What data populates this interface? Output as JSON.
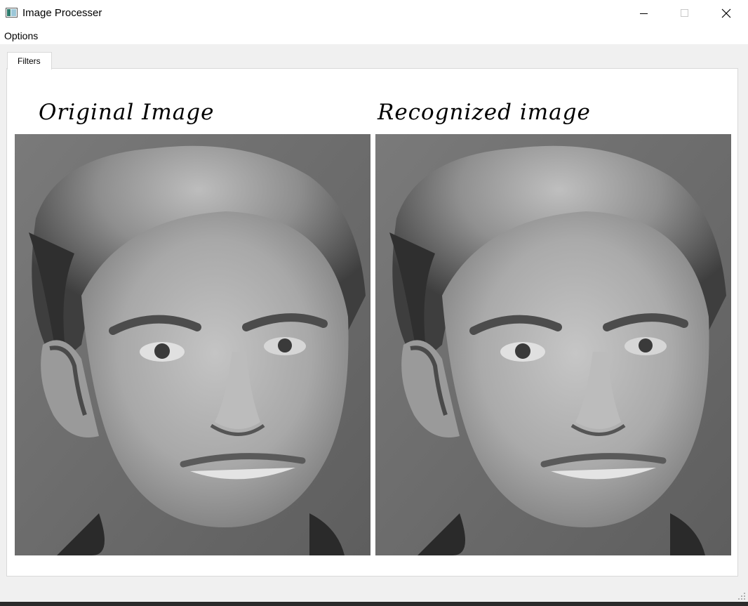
{
  "window": {
    "title": "Image Processer"
  },
  "menu": {
    "items": [
      "Options"
    ]
  },
  "tabs": [
    {
      "label": "Filters",
      "active": true
    }
  ],
  "panels": {
    "left_heading": "Original Image",
    "right_heading": "Recognized image"
  },
  "colors": {
    "window_bg": "#f0f0f0",
    "panel_bg": "#ffffff",
    "photo_bg": "#6e6e6e"
  }
}
